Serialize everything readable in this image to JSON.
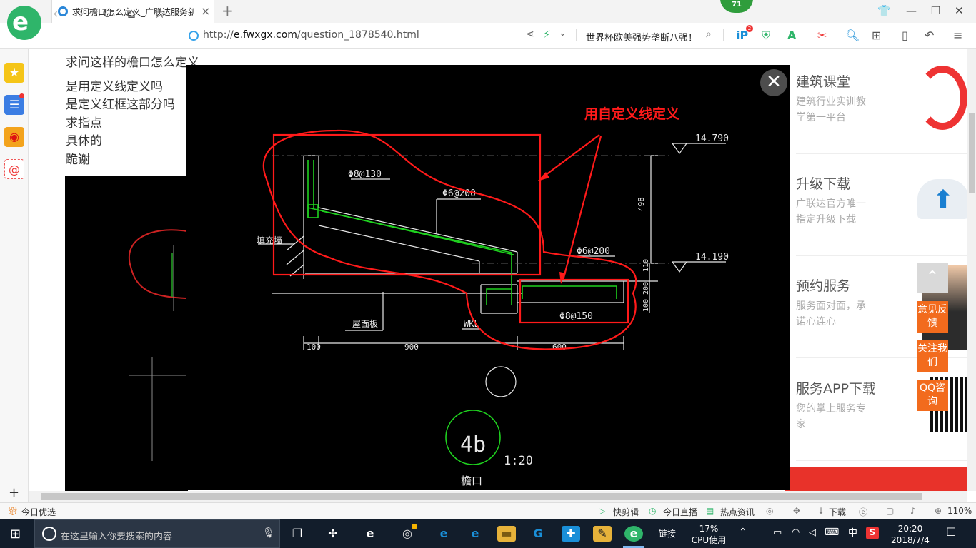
{
  "browser": {
    "tab_title": "求问檐口怎么定义_广联达服务新",
    "tab_close": "×",
    "new_tab": "+",
    "badge": "71",
    "url_prefix": "http://",
    "url_host": "e.fwxgx.com",
    "url_path": "/question_1878540.html",
    "hot_search": "世界杯欧美强势垄断八强！",
    "ip_badge": "2",
    "win_min": "—",
    "win_max": "❐",
    "win_close": "✕"
  },
  "question": {
    "lines": [
      "求问这样的檐口怎么定义",
      "是用定义线定义吗",
      "是定义红框这部分吗",
      "求指点",
      "具体的",
      "跪谢"
    ]
  },
  "right_cards": [
    {
      "title": "建筑课堂",
      "sub": "建筑行业实训教学第一平台"
    },
    {
      "title": "升级下载",
      "sub": "广联达官方唯一指定升级下载"
    },
    {
      "title": "预约服务",
      "sub": "服务面对面，承诺心连心"
    },
    {
      "title": "服务APP下载",
      "sub": "您的掌上服务专家"
    }
  ],
  "float_buttons": [
    "意见反馈",
    "关注我们",
    "QQ咨询"
  ],
  "image_viewer": {
    "annotation": "用自定义线定义",
    "elev_top": "14.790",
    "elev_mid": "14.190",
    "rebar_1": "Φ8@130",
    "rebar_2": "Φ6@200",
    "rebar_3": "Φ6@200",
    "rebar_4": "Φ8@150",
    "dim_100": "100",
    "dim_900": "900",
    "dim_600": "600",
    "dim_498": "498",
    "dim_110": "110",
    "dim_200": "200",
    "dim_100b": "100",
    "label_wall": "填充墙",
    "label_slab": "屋面板",
    "label_wkl": "WKL",
    "detail_id": "4b",
    "scale": "1:20",
    "detail_name": "檐口",
    "close": "✕"
  },
  "status_bar": {
    "left": "今日优选",
    "items": [
      "快剪辑",
      "今日直播",
      "热点资讯",
      "下载"
    ],
    "zoom": "110%"
  },
  "taskbar": {
    "search_placeholder": "在这里输入你要搜索的内容",
    "link_label": "链接",
    "cpu_percent": "17%",
    "cpu_label": "CPU使用",
    "ime": "中",
    "time": "20:20",
    "date": "2018/7/4"
  },
  "colors": {
    "accent_green": "#2fb56a",
    "float_orange": "#f26b1d",
    "cad_red": "#ff1a1a",
    "cad_green": "#1fd11f"
  }
}
